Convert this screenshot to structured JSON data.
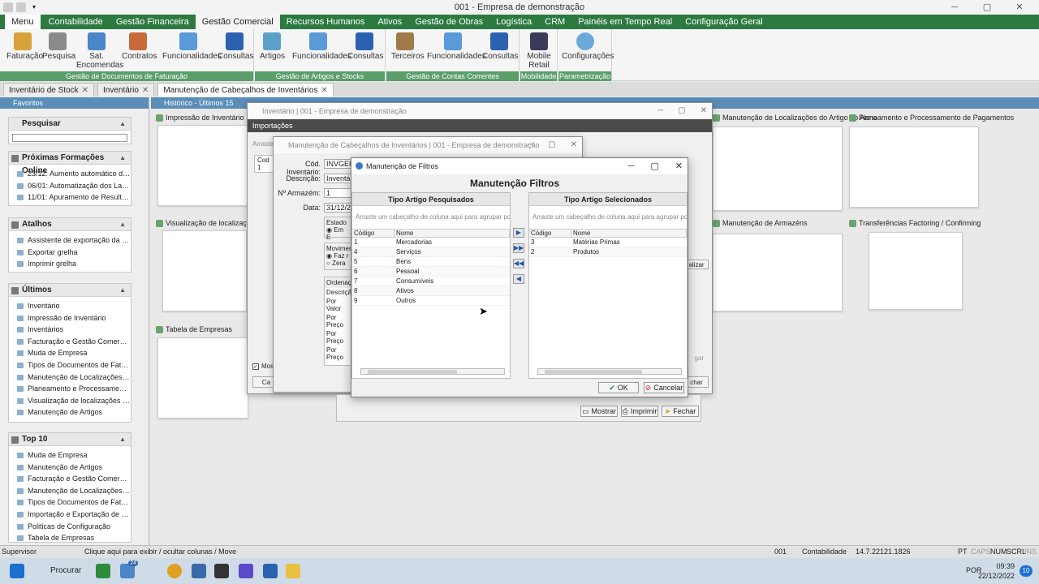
{
  "window": {
    "title": "001 - Empresa de demonstração"
  },
  "menu_tabs": [
    "Menu",
    "Contabilidade",
    "Gestão Financeira",
    "Gestão Comercial",
    "Recursos Humanos",
    "Ativos",
    "Gestão de Obras",
    "Logística",
    "CRM",
    "Painéis em Tempo Real",
    "Configuração Geral"
  ],
  "ribbon": {
    "groups": [
      {
        "label": "Gestão de Documentos de Faturação",
        "buttons": [
          "Faturação",
          "Pesquisa",
          "Sat. Encomendas",
          "Contratos",
          "Funcionalidades",
          "Consultas"
        ]
      },
      {
        "label": "Gestão de Artigos e Stocks",
        "buttons": [
          "Artigos",
          "Funcionalidades",
          "Consultas"
        ]
      },
      {
        "label": "Gestão de Contas Correntes",
        "buttons": [
          "Terceiros",
          "Funcionalidades",
          "Consultas"
        ]
      },
      {
        "label": "Mobilidade",
        "buttons": [
          "Mobile Retail"
        ]
      },
      {
        "label": "Parametrização",
        "buttons": [
          "Configurações"
        ]
      }
    ]
  },
  "doc_tabs": [
    "Inventário de Stock",
    "Inventário",
    "Manutenção de Cabeçalhos de Inventários"
  ],
  "sidebar": {
    "header": "Favoritos",
    "search_title": "Pesquisar",
    "formacoes": {
      "title": "Próximas Formações Online",
      "items": [
        "23/12: Aumento automático de venc...",
        "06/01: Automatização dos Lançame...",
        "11/01: Apuramento de Resultados e..."
      ]
    },
    "atalhos": {
      "title": "Atalhos",
      "items": [
        "Assistente de exportação da grelha",
        "Exportar grelha",
        "Imprimir grelha"
      ]
    },
    "ultimos": {
      "title": "Últimos",
      "items": [
        "Inventário",
        "Impressão de Inventário",
        "Inventários",
        "Facturação e Gestão Comercial",
        "Muda de Empresa",
        "Tipos de Documentos de Faturação",
        "Manutenção de Localizações do Arti...",
        "Planeamento e Processamento de P...",
        "Visualização de localizações artigo",
        "Manutenção de Artigos"
      ]
    },
    "top10": {
      "title": "Top 10",
      "items": [
        "Muda de Empresa",
        "Manutenção de Artigos",
        "Facturação e Gestão Comercial",
        "Manutenção de Localizações do Arti...",
        "Tipos de Documentos de Faturação",
        "Importação e Exportação de Imagen...",
        "Politicas de Configuração",
        "Tabela de Empresas"
      ]
    }
  },
  "history": {
    "header": "Histórico - Últimos 15",
    "thumbs": [
      "Impressão de Inventário",
      "Visualização de localizações arti",
      "Tabela de Empresas",
      "Manutenção de Localizações do Artigo no Arma",
      "Planeamento e Processamento de Pagamentos",
      "Manutenção de Armazéns",
      "Transferências Factoring / Confirming"
    ]
  },
  "dlg_inventario": {
    "title": "Inventário | 001 - Empresa de demonstração",
    "subheader": "Importações",
    "col": "Cod",
    "row1": "1",
    "arraste": "Arraste"
  },
  "dlg_cabecalhos": {
    "title": "Manutenção de Cabeçalhos de Inventários | 001 - Empresa de demonstração",
    "labels": {
      "cod": "Cód. Inventário:",
      "descr": "Descrição:",
      "armazem": "Nº Armazém:",
      "data": "Data:"
    },
    "values": {
      "cod": "INVGERA",
      "descr": "Inventário",
      "armazem": "1",
      "data": "31/12/20"
    },
    "estado": "Estado",
    "estado_opt": "Em E",
    "movim": "Movimen",
    "movim_opts": [
      "Faz r",
      "Zera"
    ],
    "ordenacao": "Ordenaç",
    "ordem_items": [
      "Descriçã",
      "Por Valor",
      "Por Preço",
      "Por Preço",
      "Por Preço"
    ],
    "mostrar_check": "Mos",
    "cancelar_short": "Ca",
    "atualizar": "alizar",
    "fechar_short": "char",
    "gar": "gar"
  },
  "bottom_buttons": {
    "mostrar": "Mostrar",
    "imprimir": "Imprimir",
    "fechar": "Fechar"
  },
  "filter_dialog": {
    "window_title": "Manutenção de Filtros",
    "title": "Manutenção Filtros",
    "left": {
      "header": "Tipo Artigo Pesquisados",
      "group_hint": "Arraste um cabeçalho de coluna aqui para agrupar por essa",
      "cols": [
        "Código",
        "Nome"
      ],
      "rows": [
        {
          "code": "1",
          "name": "Mercadorias"
        },
        {
          "code": "4",
          "name": "Serviços"
        },
        {
          "code": "5",
          "name": "Bens"
        },
        {
          "code": "6",
          "name": "Pessoal"
        },
        {
          "code": "7",
          "name": "Consumíveis"
        },
        {
          "code": "8",
          "name": "Ativos"
        },
        {
          "code": "9",
          "name": "Outros"
        }
      ]
    },
    "right": {
      "header": "Tipo Artigo Selecionados",
      "group_hint": "Arraste um cabeçalho de coluna aqui para agrupar por essa",
      "cols": [
        "Código",
        "Nome"
      ],
      "rows": [
        {
          "code": "3",
          "name": "Matérias Primas"
        },
        {
          "code": "2",
          "name": "Produtos"
        }
      ]
    },
    "ok": "OK",
    "cancel": "Cancelar"
  },
  "statusbar": {
    "user": "Supervisor",
    "hint": "Clique aqui para exibir / ocultar colunas / Move",
    "company": "001",
    "module": "Contabilidade",
    "version": "14.7.22121.1826",
    "lang": "PT",
    "caps": "CAPS",
    "num": "NUM",
    "scrl": "SCRL",
    "ins": "INS"
  },
  "taskbar": {
    "search": "Procurar",
    "time": "09:39",
    "date": "22/12/2022",
    "lang": "POR",
    "badge": "24",
    "notif": "10"
  }
}
